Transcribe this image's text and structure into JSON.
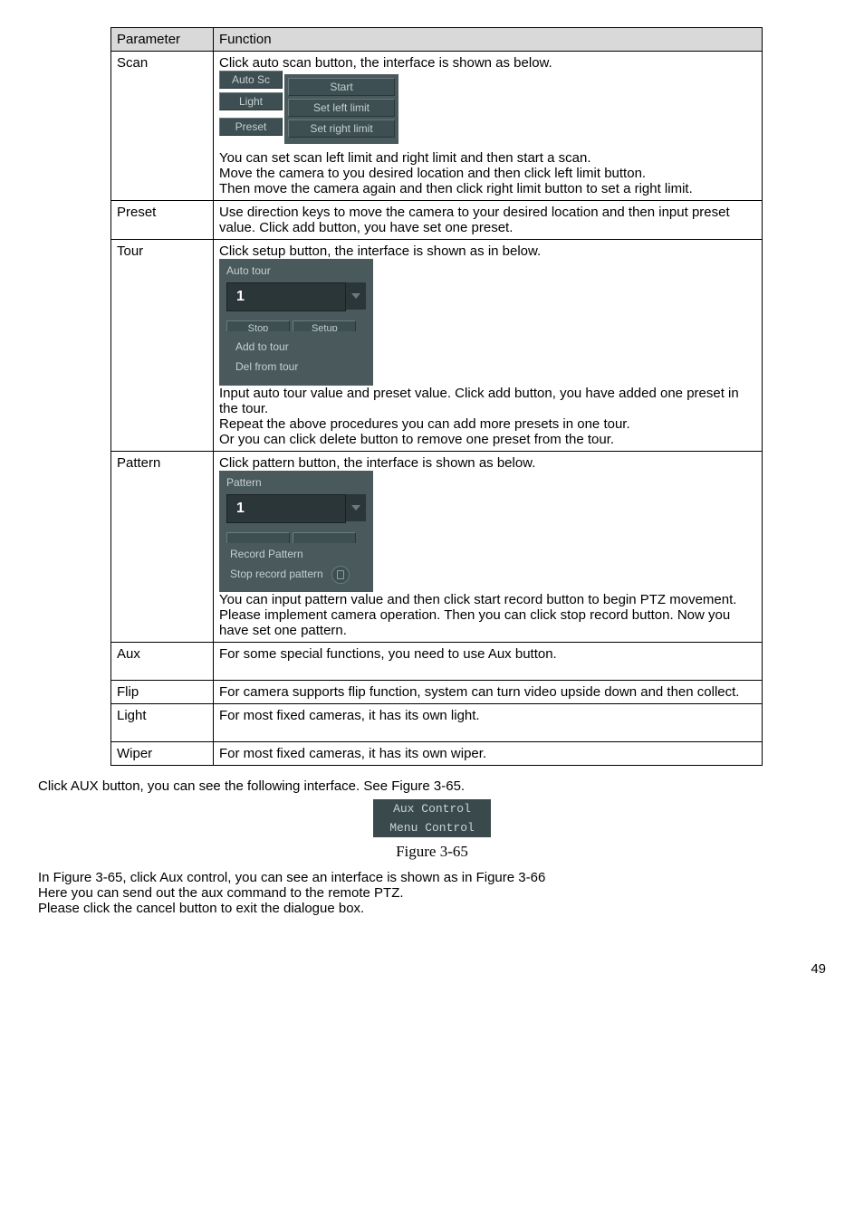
{
  "table": {
    "headers": {
      "param": "Parameter",
      "func": "Function"
    },
    "scan": {
      "param": "Scan",
      "line1": "Click auto scan button, the interface is shown as below.",
      "ui": {
        "autosc": "Auto Sc",
        "light": "Light",
        "preset": "Preset",
        "start": "Start",
        "setleft": "Set left limit",
        "setright": "Set right limit"
      },
      "p1": "You can set scan left limit and right limit and then start a scan.",
      "p2": "Move the camera to you desired location and then click left limit button.",
      "p3": "Then move the camera again and then click right limit button to set a right limit."
    },
    "preset": {
      "param": "Preset",
      "text": "Use direction keys to move the camera to your desired location and then input preset value. Click add button, you have set one preset."
    },
    "tour": {
      "param": "Tour",
      "line1": "Click setup button, the interface is shown as in below.",
      "ui": {
        "label": "Auto tour",
        "input": "1",
        "stop_cut": "Stop",
        "setup_cut": "Setup",
        "add": "Add to tour",
        "del": "Del from tour"
      },
      "p1": "Input auto tour value and preset value. Click add button, you have added one preset in the tour.",
      "p2": "Repeat the above procedures you can add more presets in one tour.",
      "p3": "Or you can click delete button to remove one preset from the tour."
    },
    "pattern": {
      "param": "Pattern",
      "line1": "Click pattern button, the interface is shown as below.",
      "ui": {
        "label": "Pattern",
        "input": "1",
        "rec": "Record Pattern",
        "stop": "Stop record pattern"
      },
      "p1": "You can input pattern value and then click start record button to begin PTZ movement. Please implement camera operation. Then you can click stop record button. Now you have set one pattern."
    },
    "aux": {
      "param": "Aux",
      "text": "For some special functions, you need to use Aux button."
    },
    "flip": {
      "param": "Flip",
      "text": "For camera supports flip function, system can turn video upside down and then collect."
    },
    "light": {
      "param": "Light",
      "text": "For most fixed cameras, it has its own light."
    },
    "wiper": {
      "param": "Wiper",
      "text": "For most fixed cameras, it has its own wiper."
    }
  },
  "after": {
    "line1": "Click AUX button, you can see the following interface. See Figure 3-65.",
    "aux_panel": {
      "aux": "Aux Control",
      "menu": "Menu Control"
    },
    "caption": "Figure 3-65",
    "line2": "In Figure 3-65, click Aux control, you can see an interface is shown as in Figure 3-66",
    "line3": "Here you can send out the aux command to the remote PTZ.",
    "line4": "Please click the cancel button to exit the dialogue box."
  },
  "page_number": "49"
}
